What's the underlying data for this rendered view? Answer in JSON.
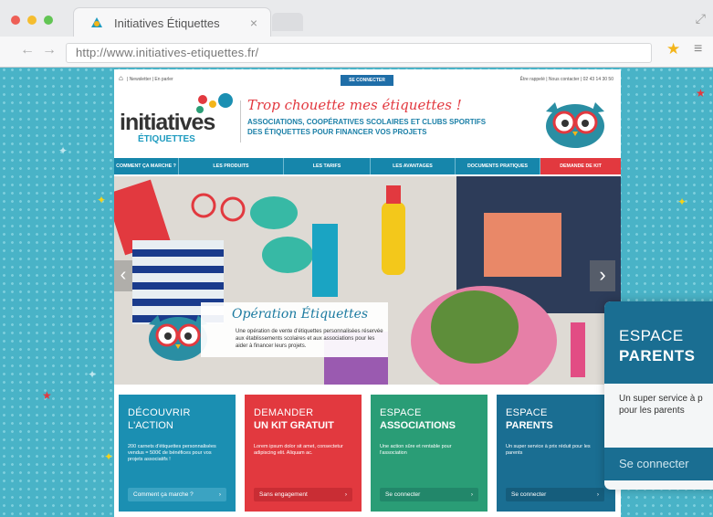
{
  "browser": {
    "tab_title": "Initiatives Étiquettes",
    "tab_close": "×",
    "url": "http://www.initiatives-etiquettes.fr/",
    "back": "←",
    "forward": "→",
    "bookmark_star": "★",
    "menu": "≡",
    "resize": "⤢",
    "traffic_light_colors": [
      "#ee5f56",
      "#f5bd2f",
      "#62c554"
    ]
  },
  "site": {
    "topbar": {
      "left": "| Newsletter | En parler",
      "connect_button": "SE CONNECTER",
      "right": "Être rappelé | Nous contacter | 02 43 14 30 50"
    },
    "logo": {
      "main": "initiatives",
      "sub": "ÉTIQUETTES"
    },
    "tagline": "Trop chouette mes étiquettes !",
    "headline_1": "ASSOCIATIONS, COOPÉRATIVES SCOLAIRES ET CLUBS SPORTIFS",
    "headline_2": "DES ÉTIQUETTES POUR FINANCER VOS PROJETS",
    "nav": [
      {
        "label": "COMMENT ÇA MARCHE ?"
      },
      {
        "label": "LES PRODUITS"
      },
      {
        "label": "LES TARIFS"
      },
      {
        "label": "LES AVANTAGES"
      },
      {
        "label": "DOCUMENTS PRATIQUES"
      },
      {
        "label": "DEMANDE DE KIT"
      }
    ],
    "hero": {
      "title": "Opération Étiquettes",
      "text": "Une opération de vente d'étiquettes personnalisées réservée aux établissements scolaires et aux associations pour les aider à financer leurs projets.",
      "prev": "‹",
      "next": "›"
    },
    "cards": [
      {
        "t1": "DÉCOUVRIR",
        "t2": "L'ACTION",
        "body": "200 carnets d'étiquettes personnalisées vendus = 500€ de bénéfices pour vos projets associatifs !",
        "button": "Comment ça marche ?",
        "color": "#1b8fb2"
      },
      {
        "t1": "DEMANDER",
        "t2": "UN KIT GRATUIT",
        "body": "Lorem ipsum dolor sit amet, consectetur adipiscing elit. Aliquam ac.",
        "button": "Sans engagement",
        "color": "#e2393f"
      },
      {
        "t1": "ESPACE",
        "t2": "ASSOCIATIONS",
        "body": "Une action sûre et rentable pour l'association",
        "button": "Se connecter",
        "color": "#2a9d76"
      },
      {
        "t1": "ESPACE",
        "t2": "PARENTS",
        "body": "Un super service à prix réduit pour les parents",
        "button": "Se connecter",
        "color": "#1a6e92"
      }
    ],
    "card_chevron": "›"
  },
  "popout": {
    "t1": "ESPACE",
    "t2": "PARENTS",
    "body_1": "Un super service à p",
    "body_2": "pour les parents",
    "button": "Se connecter"
  }
}
